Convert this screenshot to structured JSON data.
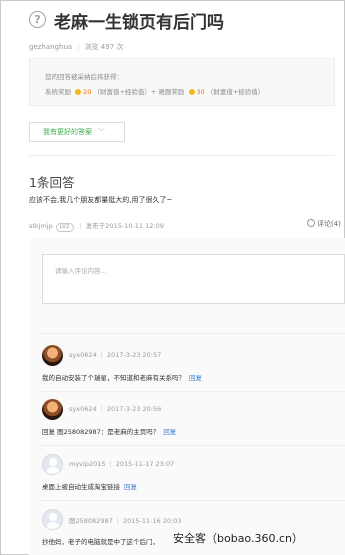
{
  "question": {
    "icon": "question-circle-icon",
    "title": "老麻一生锁页有后门吗",
    "asker": "gezhanghua",
    "views": "浏览 497 次"
  },
  "reward": {
    "intro": "您的回答被采纳后将获得：",
    "system_label": "系统奖励",
    "system_amount": "20",
    "system_unit": "（财富值+经验值）+",
    "asker_label": "难题奖励",
    "asker_amount": "30",
    "asker_unit": "（财富值+经验值）"
  },
  "better_answer_button": "我有更好的答案",
  "answers_count": "1条回答",
  "answer": {
    "text": "应该不会,我几个朋友都量挺大的,用了很久了~",
    "author": "stkjmjp",
    "level": "LV2",
    "posted": "发布于2015-10-11 12:09",
    "comment_link": "评论(4)"
  },
  "comment_box": {
    "placeholder": "请输入评论内容..."
  },
  "comments": [
    {
      "user": "syx0624",
      "date": "2017-3-23 20:57",
      "text": "我的自动安装了个瑞星，不知道和老麻有关系吗？",
      "reply": "回复",
      "avatar": "photo"
    },
    {
      "user": "syx0624",
      "date": "2017-3-23 20:56",
      "text": "回复 图258082987：是老麻的主页吗？",
      "reply": "回复",
      "avatar": "photo"
    },
    {
      "user": "myvip2015",
      "date": "2015-11-17 23:07",
      "text": "桌面上被自动生成淘宝链接",
      "reply": "回复",
      "avatar": "blank"
    },
    {
      "user": "图258082987",
      "date": "2015-11-16 20:03",
      "text": "抄他妈，老子的电脑就是中了这个后门，",
      "reply": "",
      "avatar": "blank"
    }
  ],
  "watermark": "安全客（bobao.360.cn）"
}
